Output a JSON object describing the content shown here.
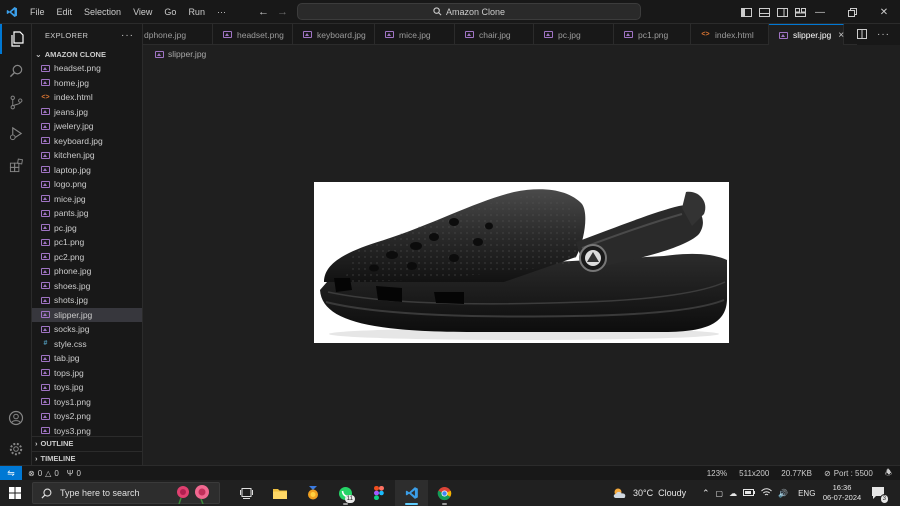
{
  "titlebar": {
    "menu": [
      "File",
      "Edit",
      "Selection",
      "View",
      "Go",
      "Run",
      "···"
    ],
    "search_text": "Amazon Clone"
  },
  "sidebar": {
    "title": "EXPLORER",
    "project": "AMAZON CLONE",
    "files": [
      {
        "name": "headset.png",
        "type": "img"
      },
      {
        "name": "home.jpg",
        "type": "img"
      },
      {
        "name": "index.html",
        "type": "html"
      },
      {
        "name": "jeans.jpg",
        "type": "img"
      },
      {
        "name": "jwelery.jpg",
        "type": "img"
      },
      {
        "name": "keyboard.jpg",
        "type": "img"
      },
      {
        "name": "kitchen.jpg",
        "type": "img"
      },
      {
        "name": "laptop.jpg",
        "type": "img"
      },
      {
        "name": "logo.png",
        "type": "img"
      },
      {
        "name": "mice.jpg",
        "type": "img"
      },
      {
        "name": "pants.jpg",
        "type": "img"
      },
      {
        "name": "pc.jpg",
        "type": "img"
      },
      {
        "name": "pc1.png",
        "type": "img"
      },
      {
        "name": "pc2.png",
        "type": "img"
      },
      {
        "name": "phone.jpg",
        "type": "img"
      },
      {
        "name": "shoes.jpg",
        "type": "img"
      },
      {
        "name": "shots.jpg",
        "type": "img"
      },
      {
        "name": "slipper.jpg",
        "type": "img",
        "selected": true
      },
      {
        "name": "socks.jpg",
        "type": "img"
      },
      {
        "name": "style.css",
        "type": "css"
      },
      {
        "name": "tab.jpg",
        "type": "img"
      },
      {
        "name": "tops.jpg",
        "type": "img"
      },
      {
        "name": "toys.jpg",
        "type": "img"
      },
      {
        "name": "toys1.png",
        "type": "img"
      },
      {
        "name": "toys2.png",
        "type": "img"
      },
      {
        "name": "toys3.png",
        "type": "img"
      }
    ],
    "outline": "OUTLINE",
    "timeline": "TIMELINE"
  },
  "tabs": [
    {
      "name": "dphone.jpg",
      "type": "img"
    },
    {
      "name": "headset.png",
      "type": "img"
    },
    {
      "name": "keyboard.jpg",
      "type": "img"
    },
    {
      "name": "mice.jpg",
      "type": "img"
    },
    {
      "name": "chair.jpg",
      "type": "img"
    },
    {
      "name": "pc.jpg",
      "type": "img"
    },
    {
      "name": "pc1.png",
      "type": "img"
    },
    {
      "name": "index.html",
      "type": "html"
    },
    {
      "name": "slipper.jpg",
      "type": "img",
      "active": true
    }
  ],
  "editor": {
    "breadcrumb": "slipper.jpg"
  },
  "statusbar": {
    "errors": "0",
    "warnings": "0",
    "ports_count": "0",
    "zoom": "123%",
    "dimensions": "511x200",
    "size": "20.77KB",
    "port": "Port : 5500"
  },
  "taskbar": {
    "search_placeholder": "Type here to search",
    "whatsapp_badge": "11",
    "temperature": "30°C",
    "weather": "Cloudy",
    "language": "ENG",
    "time": "16:36",
    "date": "06-07-2024",
    "notification_count": "3"
  },
  "colors": {
    "accent": "#0078d4",
    "image_icon": "#a074c4",
    "html_icon": "#e37933",
    "css_icon": "#519aba"
  }
}
